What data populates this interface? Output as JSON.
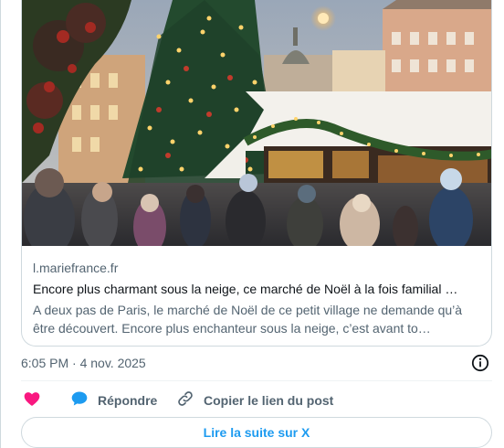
{
  "card": {
    "domain": "l.mariefrance.fr",
    "headline": "Encore plus charmant sous la neige, ce marché de Noël à la fois familial …",
    "description": "A deux pas de Paris, le marché de Noël de ce petit village ne demande qu’à être découvert. Encore plus enchanteur sous la neige, c’est avant to…"
  },
  "timestamp": "6:05 PM · 4 nov. 2025",
  "actions": {
    "like_icon": "heart-icon",
    "reply_label": "Répondre",
    "reply_icon": "speech-bubble-icon",
    "copy_label": "Copier le lien du post",
    "copy_icon": "link-icon"
  },
  "read_more_label": "Lire la suite sur X",
  "colors": {
    "like": "#f91880",
    "reply": "#1d9bf0",
    "accent": "#1d9bf0",
    "secondary_text": "#536471",
    "border": "#cfd9de"
  }
}
